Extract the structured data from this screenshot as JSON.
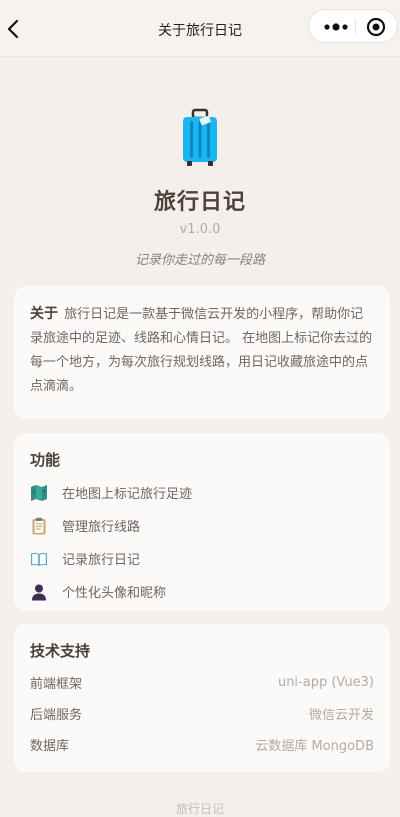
{
  "nav": {
    "title": "关于旅行日记"
  },
  "hero": {
    "name": "旅行日记",
    "version": "v1.0.0",
    "slogan": "记录你走过的每一段路"
  },
  "intro": {
    "label": "关于",
    "text": " 旅行日记是一款基于微信云开发的小程序，帮助你记录旅途中的足迹、线路和心情日记。 在地图上标记你去过的每一个地方，为每次旅行规划线路，用日记收藏旅途中的点点滴滴。"
  },
  "features": {
    "title": "功能",
    "items": [
      {
        "icon": "map-icon",
        "label": "在地图上标记旅行足迹"
      },
      {
        "icon": "clipboard-icon",
        "label": "管理旅行线路"
      },
      {
        "icon": "book-icon",
        "label": "记录旅行日记"
      },
      {
        "icon": "user-icon",
        "label": "个性化头像和昵称"
      }
    ]
  },
  "tech": {
    "title": "技术支持",
    "rows": [
      {
        "key": "前端框架",
        "value": "uni-app (Vue3)"
      },
      {
        "key": "后端服务",
        "value": "微信云开发"
      },
      {
        "key": "数据库",
        "value": "云数据库 MongoDB"
      }
    ]
  },
  "footer": {
    "text": "旅行日记"
  },
  "colors": {
    "background": "#f4efeb",
    "card": "#fcfaf8",
    "suitcase": "#19b6f0"
  }
}
